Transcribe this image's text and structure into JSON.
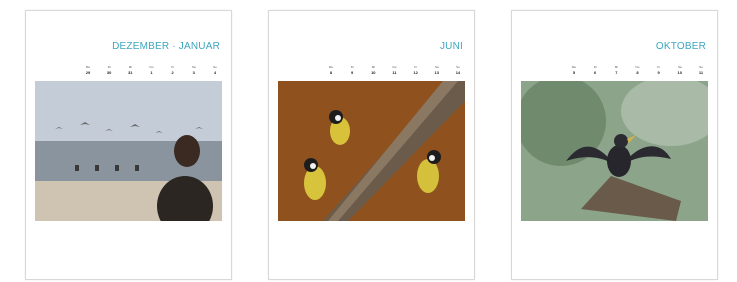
{
  "pages": [
    {
      "title": "DEZEMBER · JANUAR",
      "subtitle": "",
      "week_label": "",
      "days": [
        {
          "d": "29",
          "w": "Mo"
        },
        {
          "d": "30",
          "w": "Di"
        },
        {
          "d": "31",
          "w": "Mi"
        },
        {
          "d": "1",
          "w": "Do"
        },
        {
          "d": "2",
          "w": "Fr"
        },
        {
          "d": "3",
          "w": "Sa"
        },
        {
          "d": "4",
          "w": "So"
        }
      ],
      "photo_alt": "Person am Strand mit Möwen"
    },
    {
      "title": "JUNI",
      "subtitle": "",
      "week_label": "",
      "days": [
        {
          "d": "8",
          "w": "Mo"
        },
        {
          "d": "9",
          "w": "Di"
        },
        {
          "d": "10",
          "w": "Mi"
        },
        {
          "d": "11",
          "w": "Do"
        },
        {
          "d": "12",
          "w": "Fr"
        },
        {
          "d": "13",
          "w": "Sa"
        },
        {
          "d": "14",
          "w": "So"
        }
      ],
      "photo_alt": "Kohlmeisen an einem Ast"
    },
    {
      "title": "OKTOBER",
      "subtitle": "",
      "week_label": "",
      "days": [
        {
          "d": "5",
          "w": "Mo"
        },
        {
          "d": "6",
          "w": "Di"
        },
        {
          "d": "7",
          "w": "Mi"
        },
        {
          "d": "8",
          "w": "Do"
        },
        {
          "d": "9",
          "w": "Fr"
        },
        {
          "d": "10",
          "w": "Sa"
        },
        {
          "d": "11",
          "w": "So"
        }
      ],
      "photo_alt": "Star auf einem Ast"
    }
  ],
  "colors": {
    "accent": "#3ba6be",
    "credit": "#7cc3d3",
    "caption": "#7a7a7a"
  }
}
